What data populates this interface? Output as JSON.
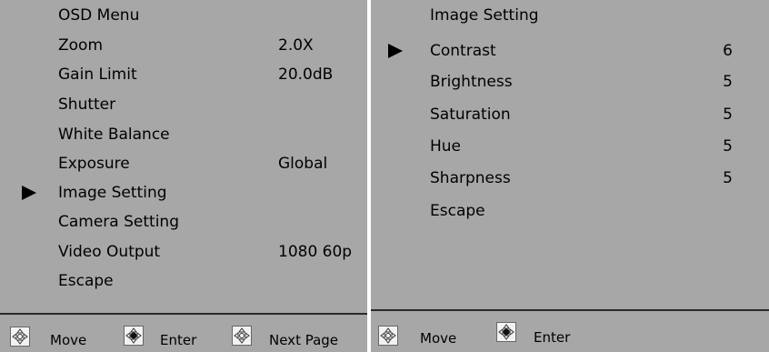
{
  "left_panel": {
    "title": "OSD Menu",
    "items": [
      {
        "label": "Zoom",
        "value": "2.0X",
        "selected": false
      },
      {
        "label": "Gain Limit",
        "value": "20.0dB",
        "selected": false
      },
      {
        "label": "Shutter",
        "value": "",
        "selected": false
      },
      {
        "label": "White Balance",
        "value": "",
        "selected": false
      },
      {
        "label": "Exposure",
        "value": "Global",
        "selected": false
      },
      {
        "label": "Image Setting",
        "value": "",
        "selected": true
      },
      {
        "label": "Camera Setting",
        "value": "",
        "selected": false
      },
      {
        "label": "Video Output",
        "value": "1080 60p",
        "selected": false
      },
      {
        "label": "Escape",
        "value": "",
        "selected": false
      }
    ],
    "footer": {
      "move_label": "Move",
      "enter_label": "Enter",
      "next_page_label": "Next Page"
    }
  },
  "right_panel": {
    "title": "Image Setting",
    "items": [
      {
        "label": "Contrast",
        "value": "6",
        "selected": true
      },
      {
        "label": "Brightness",
        "value": "5",
        "selected": false
      },
      {
        "label": "Saturation",
        "value": "5",
        "selected": false
      },
      {
        "label": "Hue",
        "value": "5",
        "selected": false
      },
      {
        "label": "Sharpness",
        "value": "5",
        "selected": false
      },
      {
        "label": "Escape",
        "value": "",
        "selected": false
      }
    ],
    "footer": {
      "move_label": "Move",
      "enter_label": "Enter"
    }
  },
  "colors": {
    "panel_bg": "#a7a7a7",
    "text": "#000000",
    "divider": "#2a2a2a"
  },
  "icons": {
    "selection": "right-triangle",
    "move": "joystick-arrows-icon",
    "enter": "joystick-press-icon",
    "next_page": "joystick-left-right-icon"
  }
}
